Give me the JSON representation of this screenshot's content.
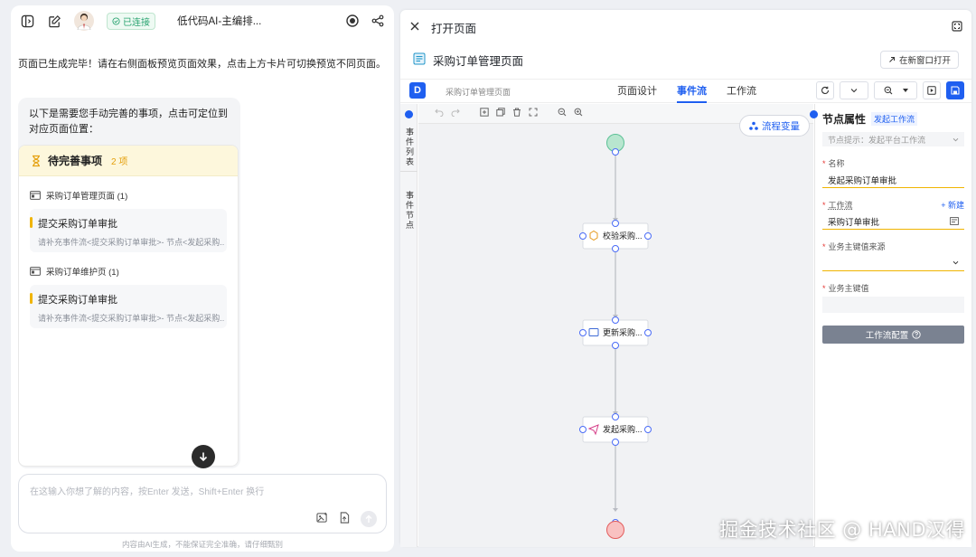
{
  "chat": {
    "status": "已连接",
    "title": "低代码AI-主编排...",
    "message": "页面已生成完毕！请在右侧面板预览页面效果，点击上方卡片可切换预览不同页面。",
    "bubble_text": "以下是需要您手动完善的事项，点击可定位到对应页面位置：",
    "todo": {
      "title": "待完善事项",
      "count": "2 项",
      "groups": [
        {
          "label": "采购订单管理页面 (1)",
          "task": "提交采购订单审批",
          "desc": "请补充事件流<提交采购订单审批>- 节点<发起采购..."
        },
        {
          "label": "采购订单维护页 (1)",
          "task": "提交采购订单审批",
          "desc": "请补充事件流<提交采购订单审批>- 节点<发起采购..."
        }
      ]
    },
    "input_placeholder": "在这输入你想了解的内容，按Enter 发送，Shift+Enter 换行",
    "disclaimer": "内容由AI生成，不能保证完全准确，请仔细甄别"
  },
  "panel": {
    "title": "打开页面",
    "page_title": "采购订单管理页面",
    "open_new": "在新窗口打开",
    "designer_page": "采购订单管理页面",
    "tabs": [
      "页面设计",
      "事件流",
      "工作流"
    ],
    "active_tab": "事件流",
    "side_tabs": [
      "事件列表",
      "事件节点"
    ],
    "flow_var": "流程变量",
    "nodes": [
      "校验采购...",
      "更新采购...",
      "发起采购..."
    ]
  },
  "props": {
    "title": "节点属性",
    "tag": "发起工作流",
    "hint": "节点提示：发起平台工作流",
    "name_label": "名称",
    "name_value": "发起采购订单审批",
    "workflow_label": "工作流",
    "new_label": "+ 新建",
    "workflow_value": "采购订单审批",
    "bizkey_source_label": "业务主键值来源",
    "bizkey_label": "业务主键值",
    "config_button": "工作流配置"
  },
  "colors": {
    "primary": "#1f5ff0",
    "warning": "#f0b400",
    "success": "#2ba471"
  },
  "watermark": "掘金技术社区 @ HAND汉得"
}
